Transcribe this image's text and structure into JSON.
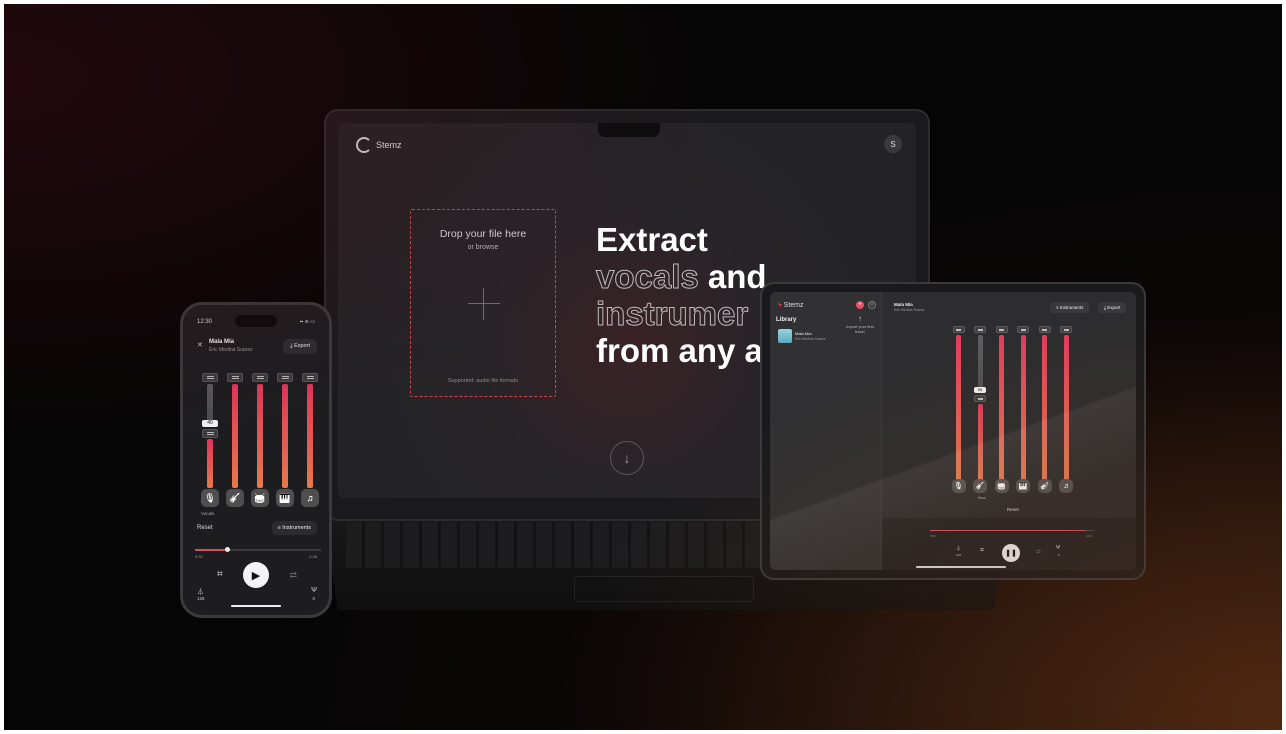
{
  "laptop": {
    "brand": "Stemz",
    "avatar": "S",
    "dropzone": {
      "title": "Drop your file here",
      "subtitle": "or browse",
      "formats": "Supported: audio file formats"
    },
    "hero": {
      "line1": "Extract",
      "line2_outline": "vocals",
      "line2_solid": " and",
      "line3_outline": "instrumer",
      "line4": "from any a"
    },
    "scroll_icon": "arrow-down-icon"
  },
  "phone": {
    "time": "12:30",
    "status_icons": "▪▪ ≋ ▭",
    "track_title": "Mala Mía",
    "track_artist": "Eric Medina Suarez",
    "export_label": "Export",
    "vocals_level": "40",
    "selected_stem_label": "Vocals",
    "reset_label": "Reset",
    "instruments_label": "Instruments",
    "time_elapsed": "0:32",
    "time_remaining": "-1:28",
    "progress": 0.25,
    "bpm": "126",
    "pitch": "0",
    "stems": [
      {
        "icon": "microphone-icon",
        "level": 0.6,
        "muted": true
      },
      {
        "icon": "guitar-icon",
        "level": 1.0,
        "muted": false
      },
      {
        "icon": "drum-icon",
        "level": 1.0,
        "muted": false
      },
      {
        "icon": "piano-icon",
        "level": 1.0,
        "muted": false
      },
      {
        "icon": "music-notes-icon",
        "level": 1.0,
        "muted": false
      }
    ]
  },
  "tablet": {
    "brand": "Stemz",
    "library_label": "Library",
    "song": "Mala Mía",
    "song_artist": "Eric Medina Suarez",
    "hint": "Import your first track!",
    "track_title": "Mala Mía",
    "track_artist": "Eric Medina Suarez",
    "instruments_label": "Instruments",
    "export_label": "Export",
    "bass_level": "58",
    "selected_stem_label": "Bass",
    "reset_label": "Reset",
    "time_elapsed": "0:00",
    "time_total": "3:00",
    "progress": 0.95,
    "bpm": "126",
    "pitch": "0",
    "stems": [
      {
        "icon": "microphone-icon",
        "level": 1.0,
        "muted": false
      },
      {
        "icon": "guitar-icon",
        "level": 0.6,
        "muted": true
      },
      {
        "icon": "drum-icon",
        "level": 1.0,
        "muted": false
      },
      {
        "icon": "piano-icon",
        "level": 1.0,
        "muted": false
      },
      {
        "icon": "violin-icon",
        "level": 1.0,
        "muted": false
      },
      {
        "icon": "music-notes-icon",
        "level": 1.0,
        "muted": false
      }
    ]
  },
  "colors": {
    "accent": "#e24a5a",
    "fader_top": "#e0355a",
    "fader_bottom": "#e47a4e",
    "background": "#050505"
  }
}
